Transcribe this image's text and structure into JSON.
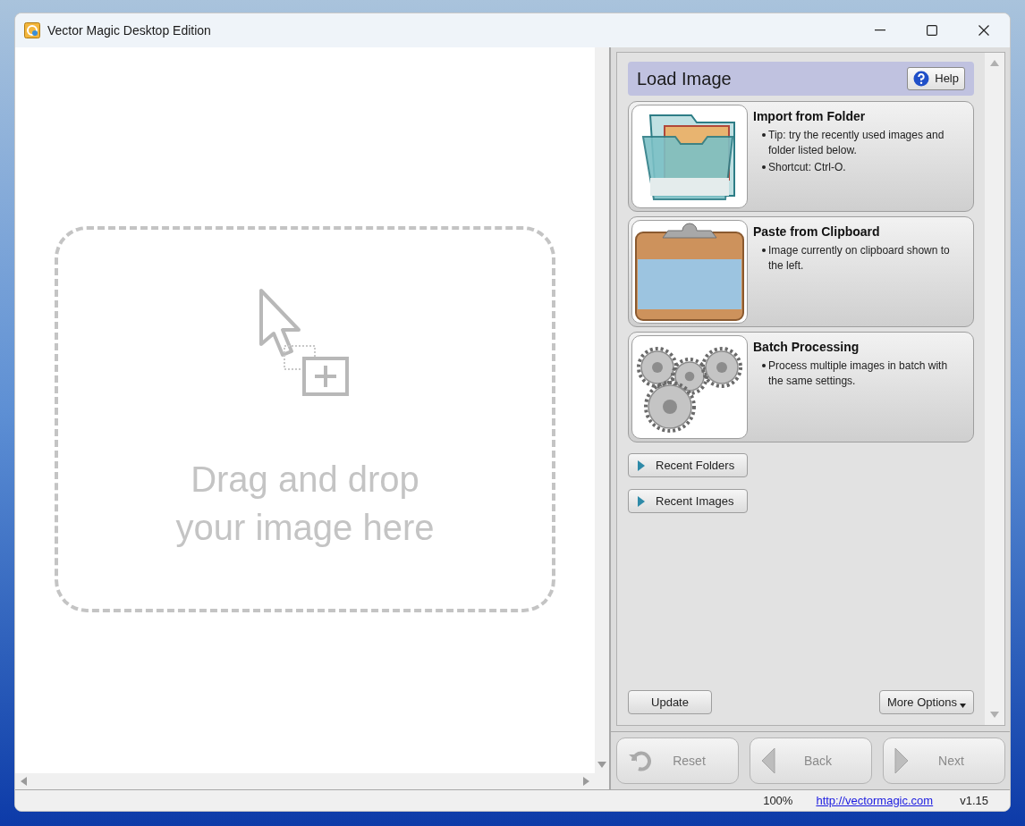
{
  "window": {
    "title": "Vector Magic Desktop Edition"
  },
  "canvas": {
    "hint_lines": [
      "Drag and drop",
      "your image here"
    ]
  },
  "panel": {
    "title": "Load Image",
    "help_button": "Help",
    "actions": [
      {
        "kind": "folder",
        "title": "Import from Folder",
        "bullets": [
          "Tip: try the recently used images and folder listed below.",
          "Shortcut: Ctrl-O."
        ]
      },
      {
        "kind": "clipboard",
        "title": "Paste from Clipboard",
        "bullets": [
          "Image currently on clipboard shown to the left."
        ]
      },
      {
        "kind": "gears",
        "title": "Batch Processing",
        "bullets": [
          "Process multiple images in batch with the same settings."
        ]
      }
    ],
    "expanders": [
      {
        "label": "Recent Folders",
        "expanded": false
      },
      {
        "label": "Recent Images",
        "expanded": false
      }
    ],
    "update_button": "Update",
    "more_options_button": "More Options"
  },
  "nav_buttons": [
    {
      "kind": "reset",
      "label": "Reset",
      "disabled": true
    },
    {
      "kind": "back",
      "label": "Back",
      "disabled": true
    },
    {
      "kind": "next",
      "label": "Next",
      "disabled": true
    }
  ],
  "status_bar": {
    "zoom": "100%",
    "link": "http://vectormagic.com",
    "version": "v1.15"
  }
}
